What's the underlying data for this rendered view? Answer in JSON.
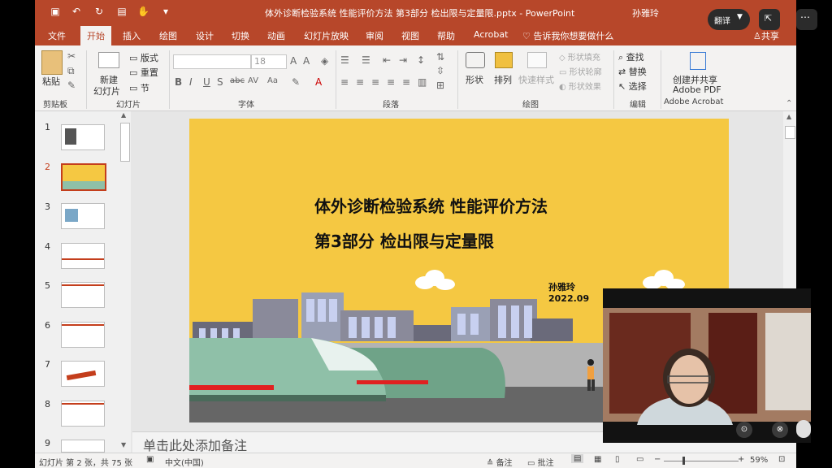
{
  "titlebar": {
    "doc_title": "体外诊断检验系统 性能评价方法 第3部分 检出限与定量限.pptx - PowerPoint",
    "user": "孙雅玲"
  },
  "tabs": [
    "文件",
    "开始",
    "插入",
    "绘图",
    "设计",
    "切换",
    "动画",
    "幻灯片放映",
    "审阅",
    "视图",
    "帮助",
    "Acrobat"
  ],
  "tell_me": "告诉我你想要做什么",
  "share": "共享",
  "ribbon": {
    "clipboard": {
      "paste": "粘贴",
      "group": "剪贴板"
    },
    "slides": {
      "new_slide_1": "新建",
      "new_slide_2": "幻灯片",
      "layout": "版式",
      "reset": "重置",
      "section": "节",
      "group": "幻灯片"
    },
    "font": {
      "size": "18",
      "group": "字体",
      "buttons": [
        "B",
        "I",
        "U",
        "S",
        "abc",
        "AV",
        "Aa",
        "A"
      ]
    },
    "paragraph": {
      "group": "段落"
    },
    "drawing": {
      "shapes": "形状",
      "arrange": "排列",
      "quick_styles": "快速样式",
      "fill": "形状填充",
      "outline": "形状轮廓",
      "effects": "形状效果",
      "group": "绘图"
    },
    "editing": {
      "find": "查找",
      "replace": "替换",
      "select": "选择",
      "group": "编辑"
    },
    "acrobat": {
      "create_1": "创建并共享",
      "create_2": "Adobe PDF",
      "group": "Adobe Acrobat"
    }
  },
  "slide_numbers": [
    "1",
    "2",
    "3",
    "4",
    "5",
    "6",
    "7",
    "8",
    "9"
  ],
  "selected_slide": 2,
  "slide": {
    "title_line1": "体外诊断检验系统 性能评价方法",
    "title_line2": "第3部分 检出限与定量限",
    "author": "孙雅玲",
    "date": "2022.09"
  },
  "notes_placeholder": "单击此处添加备注",
  "status": {
    "slide_info": "幻灯片 第 2 张，共 75 张",
    "language": "中文(中国)",
    "notes": "备注",
    "comments": "批注",
    "zoom": "59%"
  },
  "overlay": {
    "translate_pill": "翻译"
  },
  "colors": {
    "accent": "#b7472a",
    "slide_bg": "#f5c842",
    "train": "#8fc0a8",
    "stripe": "#e02020"
  }
}
